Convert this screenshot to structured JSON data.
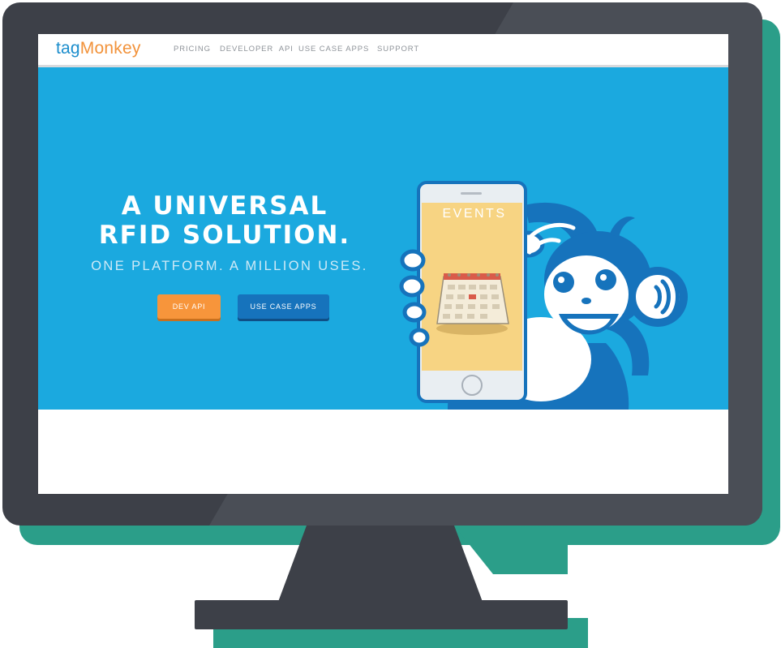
{
  "colors": {
    "monitor_frame": "#3d4048",
    "accent_shadow": "#2b9e89",
    "hero_background": "#1ba9df",
    "primary_button": "#f7953b",
    "secondary_button": "#1673bc",
    "logo_tag": "#1b8dcc",
    "logo_monkey": "#f2923a"
  },
  "header": {
    "logo_tag": "tag",
    "logo_monkey": "Monkey",
    "nav": [
      "PRICING",
      "DEVELOPER  API",
      "USE CASE APPS",
      "SUPPORT"
    ]
  },
  "hero": {
    "title_line1": "A UNIVERSAL",
    "title_line2": "RFID SOLUTION.",
    "subtitle": "ONE PLATFORM. A MILLION USES.",
    "primary_cta": "DEV API",
    "secondary_cta": "USE CASE APPS",
    "phone_screen_label": "EVENTS",
    "icons": [
      "smartphone-icon",
      "calendar-icon",
      "monkey-mascot-icon",
      "rfid-wave-icon"
    ]
  }
}
